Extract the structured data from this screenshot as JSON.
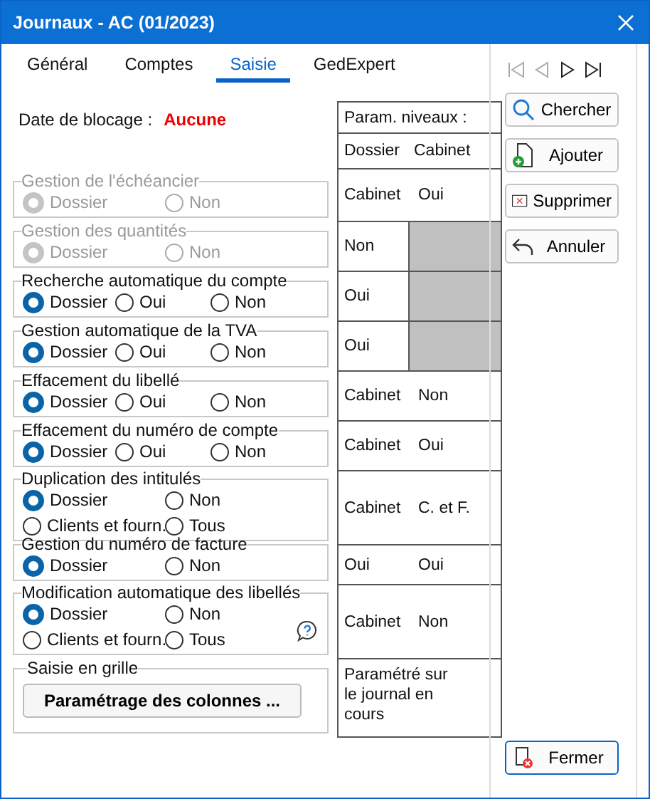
{
  "window": {
    "title": "Journaux - AC (01/2023)"
  },
  "tabs": [
    {
      "label": "Général",
      "selected": false
    },
    {
      "label": "Comptes",
      "selected": false
    },
    {
      "label": "Saisie",
      "selected": true
    },
    {
      "label": "GedExpert",
      "selected": false
    }
  ],
  "blocking": {
    "label": "Date de blocage :",
    "value": "Aucune"
  },
  "levels_table": {
    "title": "Param. niveaux :",
    "columns": [
      "Dossier",
      "Cabinet"
    ]
  },
  "groups": [
    {
      "title": "Gestion de l'échéancier",
      "disabled": true,
      "options": [
        {
          "label": "Dossier",
          "selected": true
        },
        {
          "label": "Non",
          "selected": false
        }
      ],
      "levels": [
        "Cabinet",
        "Oui"
      ]
    },
    {
      "title": "Gestion des quantités",
      "disabled": true,
      "options": [
        {
          "label": "Dossier",
          "selected": true
        },
        {
          "label": "Non",
          "selected": false
        }
      ],
      "levels": [
        "Non"
      ]
    },
    {
      "title": "Recherche automatique du compte",
      "disabled": false,
      "options": [
        {
          "label": "Dossier",
          "selected": true
        },
        {
          "label": "Oui",
          "selected": false
        },
        {
          "label": "Non",
          "selected": false
        }
      ],
      "levels": [
        "Oui"
      ]
    },
    {
      "title": "Gestion automatique de la TVA",
      "disabled": false,
      "options": [
        {
          "label": "Dossier",
          "selected": true
        },
        {
          "label": "Oui",
          "selected": false
        },
        {
          "label": "Non",
          "selected": false
        }
      ],
      "levels": [
        "Oui"
      ]
    },
    {
      "title": "Effacement du libellé",
      "disabled": false,
      "options": [
        {
          "label": "Dossier",
          "selected": true
        },
        {
          "label": "Oui",
          "selected": false
        },
        {
          "label": "Non",
          "selected": false
        }
      ],
      "levels": [
        "Cabinet",
        "Non"
      ]
    },
    {
      "title": "Effacement du numéro de compte",
      "disabled": false,
      "options": [
        {
          "label": "Dossier",
          "selected": true
        },
        {
          "label": "Oui",
          "selected": false
        },
        {
          "label": "Non",
          "selected": false
        }
      ],
      "levels": [
        "Cabinet",
        "Oui"
      ]
    },
    {
      "title": "Duplication des intitulés",
      "disabled": false,
      "options": [
        {
          "label": "Dossier",
          "selected": true
        },
        {
          "label": "Non",
          "selected": false
        },
        {
          "label": "Clients et fourn.",
          "selected": false
        },
        {
          "label": "Tous",
          "selected": false
        }
      ],
      "levels": [
        "Cabinet",
        "C. et F."
      ]
    },
    {
      "title": "Gestion du numéro de facture",
      "disabled": false,
      "options": [
        {
          "label": "Dossier",
          "selected": true
        },
        {
          "label": "Non",
          "selected": false
        }
      ],
      "levels": [
        "Oui",
        "Oui"
      ]
    },
    {
      "title": "Modification automatique des libellés",
      "disabled": false,
      "help": true,
      "options": [
        {
          "label": "Dossier",
          "selected": true
        },
        {
          "label": "Non",
          "selected": false
        },
        {
          "label": "Clients et fourn.",
          "selected": false
        },
        {
          "label": "Tous",
          "selected": false
        }
      ],
      "levels": [
        "Cabinet",
        "Non"
      ]
    }
  ],
  "grid_entry": {
    "title": "Saisie en grille",
    "button": "Paramétrage des colonnes ...",
    "note": "Paramétré sur le journal en cours"
  },
  "actions": [
    {
      "label": "Chercher",
      "kind": "search"
    },
    {
      "label": "Ajouter",
      "kind": "add"
    },
    {
      "label": "Supprimer",
      "kind": "delete"
    },
    {
      "label": "Annuler",
      "kind": "undo"
    }
  ],
  "close_button": "Fermer"
}
